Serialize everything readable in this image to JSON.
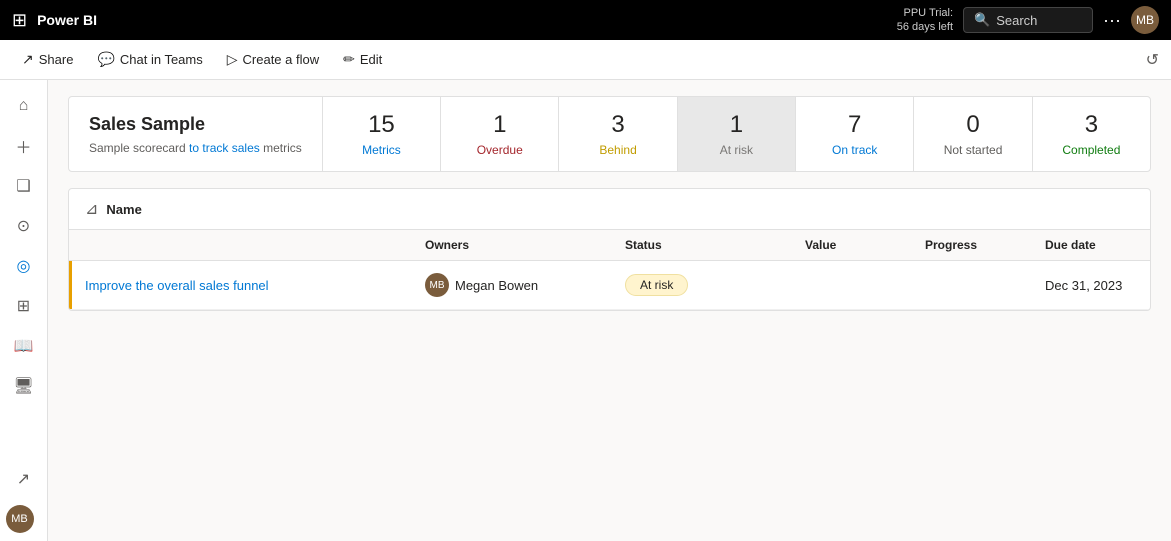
{
  "topbar": {
    "title": "Power BI",
    "trial_line1": "PPU Trial:",
    "trial_line2": "56 days left",
    "search_placeholder": "Search"
  },
  "actionbar": {
    "share_label": "Share",
    "chat_label": "Chat in Teams",
    "create_flow_label": "Create a flow",
    "edit_label": "Edit"
  },
  "scorecard": {
    "title": "Sales Sample",
    "description_prefix": "Sample scorecard ",
    "description_link": "to track sales",
    "description_suffix": " metrics",
    "metrics": [
      {
        "number": "15",
        "label": "Metrics",
        "style": "label-metrics"
      },
      {
        "number": "1",
        "label": "Overdue",
        "style": "label-overdue"
      },
      {
        "number": "3",
        "label": "Behind",
        "style": "label-behind"
      },
      {
        "number": "1",
        "label": "At risk",
        "style": "label-atrisk",
        "active": true
      },
      {
        "number": "7",
        "label": "On track",
        "style": "label-ontrack"
      },
      {
        "number": "0",
        "label": "Not started",
        "style": "label-notstarted"
      },
      {
        "number": "3",
        "label": "Completed",
        "style": "label-completed"
      }
    ]
  },
  "table": {
    "columns": [
      "Name",
      "Owners",
      "Status",
      "Value",
      "Progress",
      "Due date"
    ],
    "rows": [
      {
        "name": "Improve the overall sales funnel",
        "owner_name": "Megan Bowen",
        "status": "At risk",
        "value": "",
        "progress": "",
        "due_date": "Dec 31, 2023"
      }
    ]
  },
  "sidebar": {
    "icons": [
      {
        "name": "waffle-icon",
        "symbol": "⊞"
      },
      {
        "name": "home-icon",
        "symbol": "⌂"
      },
      {
        "name": "create-icon",
        "symbol": "+"
      },
      {
        "name": "browse-icon",
        "symbol": "❑"
      },
      {
        "name": "data-hub-icon",
        "symbol": "⊙"
      },
      {
        "name": "goals-icon",
        "symbol": "◎"
      },
      {
        "name": "apps-icon",
        "symbol": "⊞"
      },
      {
        "name": "learn-icon",
        "symbol": "📖"
      },
      {
        "name": "monitor-icon",
        "symbol": "🖥"
      },
      {
        "name": "expand-icon",
        "symbol": "↗"
      }
    ]
  }
}
